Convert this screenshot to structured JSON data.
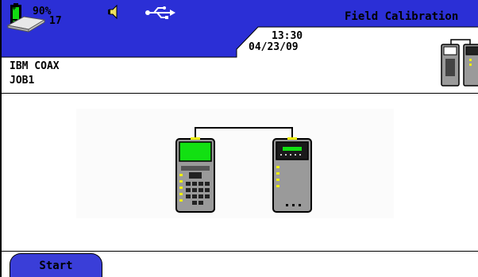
{
  "status": {
    "battery_percent": "90%",
    "storage_count": "17",
    "time": "13:30",
    "date": "04/23/09",
    "icons": [
      "battery-icon",
      "storage-disk-icon",
      "speaker-icon",
      "usb-icon"
    ]
  },
  "header": {
    "title": "Field Calibration",
    "job_line1": "IBM COAX",
    "job_line2": "JOB1"
  },
  "softkeys": {
    "start_label": "Start"
  },
  "colors": {
    "statusbar": "#2b2fd6",
    "softkey": "#3a3ed8",
    "screen_green": "#12e012",
    "led_yellow": "#f0f000",
    "device_body": "#9a9a9a"
  }
}
